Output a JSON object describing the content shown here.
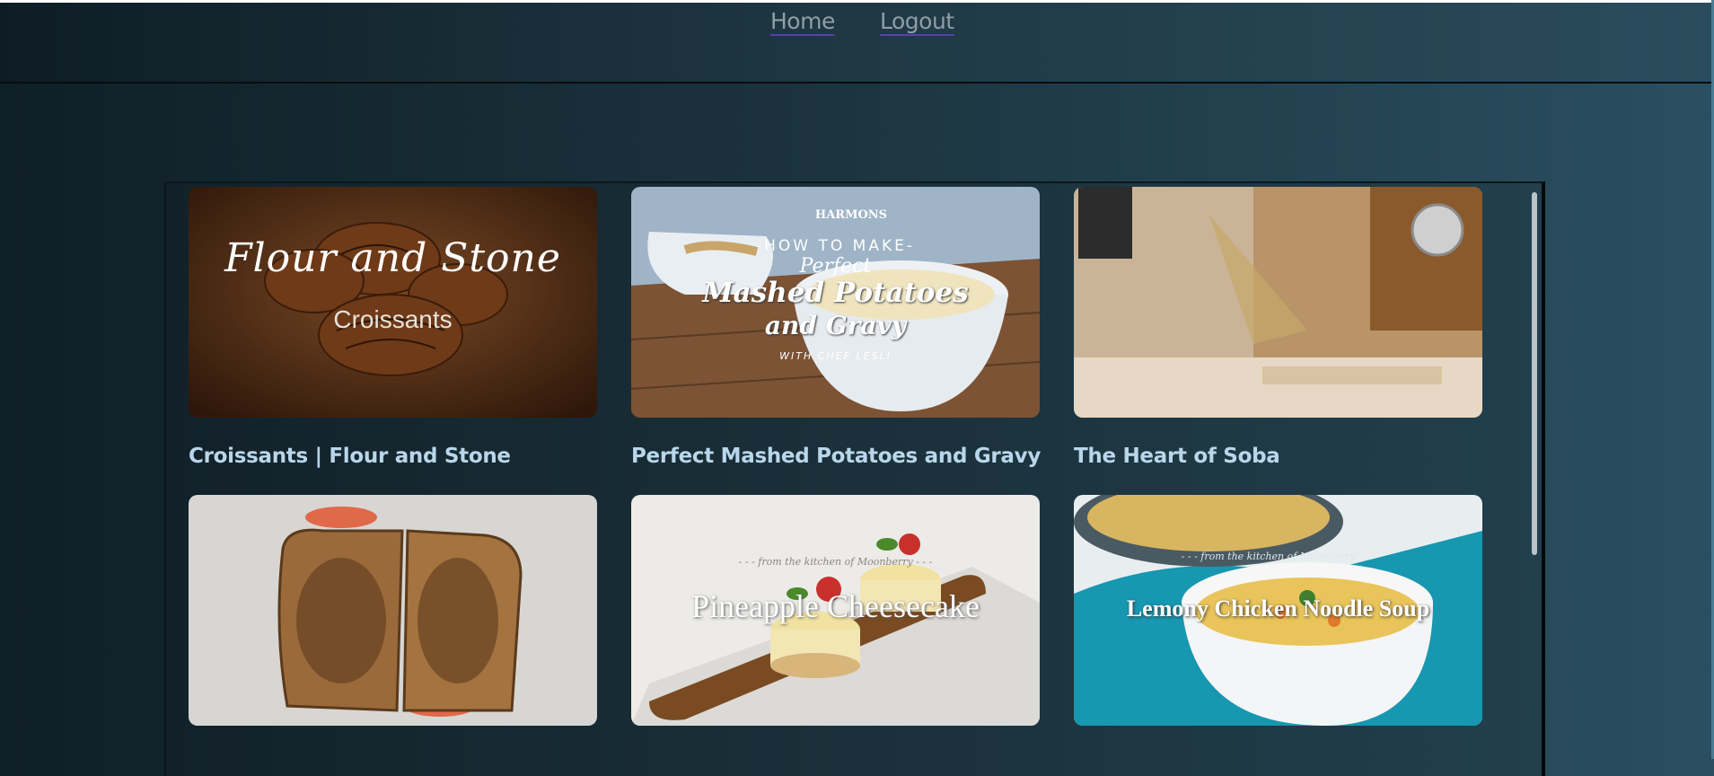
{
  "nav": {
    "home_label": "Home",
    "logout_label": "Logout"
  },
  "videos": [
    {
      "title": "Croissants | Flour and Stone",
      "overlay_script": "Flour and Stone",
      "overlay_sub": "Croissants"
    },
    {
      "title": "Perfect Mashed Potatoes and Gravy",
      "overlay_brand": "HARMONS",
      "overlay_top": "-HOW TO MAKE-",
      "overlay_perfect": "Perfect",
      "overlay_main1": "Mashed Potatoes",
      "overlay_main2": "and Gravy",
      "overlay_sub": "WITH CHEF LESLI"
    },
    {
      "title": "The Heart of Soba"
    },
    {
      "title": ""
    },
    {
      "title": "",
      "overlay_small": "- - - from the kitchen of Moonberry - - -",
      "overlay_main": "Pineapple Cheesecake"
    },
    {
      "title": "",
      "overlay_small": "- - - from the kitchen of Moonberry - - -",
      "overlay_main": "Lemony Chicken Noodle Soup"
    }
  ]
}
